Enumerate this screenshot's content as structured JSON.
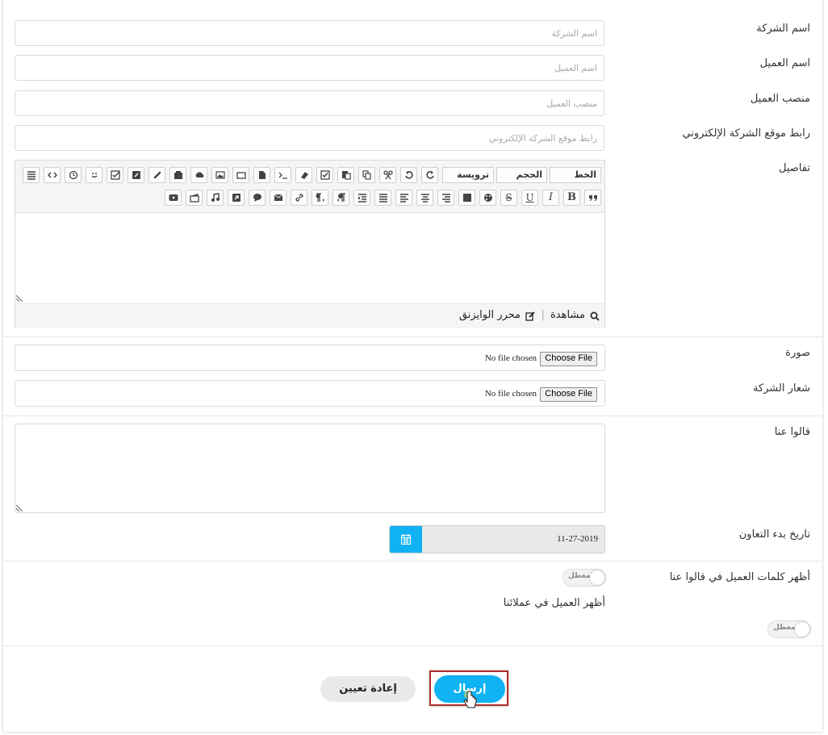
{
  "fields": {
    "company_name": {
      "label": "اسم الشركة",
      "placeholder": "اسم الشركة"
    },
    "client_name": {
      "label": "اسم العميل",
      "placeholder": "اسم العميل"
    },
    "client_position": {
      "label": "منصب العميل",
      "placeholder": "منصب العميل"
    },
    "website": {
      "label": "رابط موقع الشركة الإلكتروني",
      "placeholder": "رابط موقع الشركة الإلكتروني"
    },
    "details": {
      "label": "تفاصيل"
    }
  },
  "editor": {
    "font_select": "الخط",
    "size_select": "الحجم",
    "heading_select": "ترويسة",
    "bold": "B",
    "italic": "I",
    "underline": "U",
    "strike": "S",
    "footer_preview": "مشاهدة",
    "footer_separator": "|",
    "footer_wysiwyg": "محرر الوايزنق"
  },
  "image": {
    "label": "صورة",
    "button": "Choose File",
    "status": "No file chosen"
  },
  "logo": {
    "label": "شعار الشركة",
    "button": "Choose File",
    "status": "No file chosen"
  },
  "testimonial": {
    "label": "قالوا عنا"
  },
  "date": {
    "label": "تاريخ بدء التعاون",
    "value": "11-27-2019"
  },
  "toggles": {
    "show_testimonial": {
      "label": "أظهر كلمات العميل في قالوا عنا",
      "state": "معطل"
    },
    "show_client": {
      "label": "أظهر العميل في عملائنا",
      "state": "معطل"
    }
  },
  "actions": {
    "submit": "إرسال",
    "reset": "إعادة تعيين"
  },
  "colors": {
    "accent": "#0fb2f3",
    "highlight_border": "#b02a2a"
  }
}
